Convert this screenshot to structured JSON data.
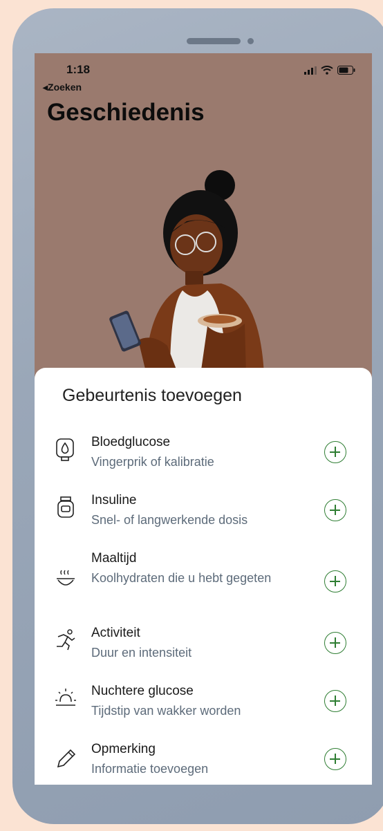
{
  "status": {
    "time": "1:18"
  },
  "nav": {
    "back_label": "Zoeken"
  },
  "header": {
    "title": "Geschiedenis"
  },
  "sheet": {
    "title": "Gebeurtenis toevoegen",
    "items": [
      {
        "icon": "blood-drop-icon",
        "title": "Bloedglucose",
        "subtitle": "Vingerprik of kalibratie"
      },
      {
        "icon": "insulin-vial-icon",
        "title": "Insuline",
        "subtitle": "Snel- of langwerkende dosis"
      },
      {
        "icon": "meal-bowl-icon",
        "title": "Maaltijd",
        "subtitle": "Koolhydraten die u hebt gegeten"
      },
      {
        "icon": "running-icon",
        "title": "Activiteit",
        "subtitle": "Duur en intensiteit"
      },
      {
        "icon": "sunrise-icon",
        "title": "Nuchtere glucose",
        "subtitle": "Tijdstip van wakker worden"
      },
      {
        "icon": "pencil-icon",
        "title": "Opmerking",
        "subtitle": "Informatie toevoegen"
      }
    ]
  },
  "colors": {
    "accent": "#2e7d32",
    "screen_bg": "#9a7a6e",
    "page_bg": "#fbe3d3"
  }
}
